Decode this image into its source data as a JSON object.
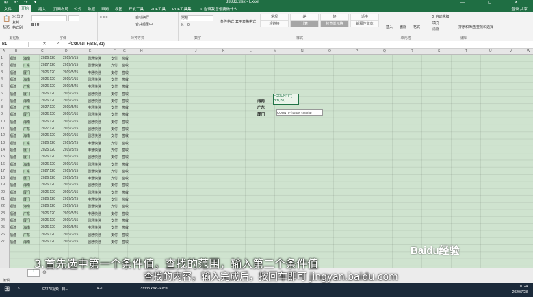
{
  "window": {
    "title": "33333.xlsx - Excel",
    "quick_access": "⊞ ↶ ↷ ▾",
    "controls": "— ▢ ✕"
  },
  "menu": {
    "tabs": [
      "文件",
      "开始",
      "插入",
      "页面布局",
      "公式",
      "数据",
      "审阅",
      "视图",
      "开发工具",
      "PDF工具",
      "PDF工具集"
    ],
    "search": "♀ 告诉我您想要做什么...",
    "right": "登录 共享"
  },
  "ribbon": {
    "clipboard": {
      "label": "剪贴板",
      "paste": "粘贴",
      "cut": "✂ 剪切",
      "copy": "复制",
      "format_painter": "格式刷"
    },
    "font": {
      "label": "字体"
    },
    "alignment": {
      "label": "对齐方式",
      "wrap": "自动换行",
      "merge": "合并后居中"
    },
    "number": {
      "label": "数字",
      "format": "常规"
    },
    "styles": {
      "label": "样式",
      "cond": "条件格式",
      "table": "套用表格格式",
      "items": [
        "常规",
        "差",
        "好",
        "适中",
        "超链接",
        "计算",
        "检查单元格",
        "解释性文本",
        "警告文本",
        "链接"
      ]
    },
    "cells": {
      "label": "单元格",
      "insert": "插入",
      "delete": "删除",
      "format": "格式"
    },
    "editing": {
      "label": "编辑",
      "autosum": "Σ 自动求和",
      "fill": "填充",
      "clear": "清除",
      "sort": "排序和筛选",
      "find": "查找和选择"
    }
  },
  "formula_bar": {
    "name_box": "B1",
    "icons": "✕ ✓ fx",
    "formula": "=COUNTIF(B:B,B1)"
  },
  "columns": [
    "A",
    "B",
    "C",
    "D",
    "E",
    "F",
    "G",
    "H",
    "I",
    "J",
    "K",
    "L",
    "M",
    "N",
    "O",
    "P",
    "Q",
    "R",
    "S",
    "T",
    "U",
    "V",
    "W"
  ],
  "rows": [
    [
      "福建",
      "海南",
      "2026.120",
      "2019/7/15",
      "圆通快递",
      "支付",
      "签收"
    ],
    [
      "福建",
      "广东",
      "2027.120",
      "2019/7/15",
      "圆通快递",
      "支付",
      "签收"
    ],
    [
      "福建",
      "厦门",
      "2026.120",
      "2019/5/25",
      "申通快递",
      "支付",
      "签收"
    ],
    [
      "福建",
      "海南",
      "2026.120",
      "2019/7/15",
      "圆通快递",
      "支付",
      "签收"
    ],
    [
      "福建",
      "广东",
      "2026.120",
      "2019/5/25",
      "申通快递",
      "支付",
      "签收"
    ],
    [
      "福建",
      "厦门",
      "2026.120",
      "2019/7/15",
      "圆通快递",
      "支付",
      "签收"
    ],
    [
      "福建",
      "海南",
      "2026.120",
      "2019/7/15",
      "圆通快递",
      "支付",
      "签收"
    ],
    [
      "福建",
      "广东",
      "2027.120",
      "2019/5/25",
      "申通快递",
      "支付",
      "签收"
    ],
    [
      "福建",
      "厦门",
      "2026.120",
      "2019/7/15",
      "圆通快递",
      "支付",
      "签收"
    ],
    [
      "福建",
      "海南",
      "2026.120",
      "2019/7/15",
      "圆通快递",
      "支付",
      "签收"
    ],
    [
      "福建",
      "广东",
      "2027.120",
      "2019/7/15",
      "圆通快递",
      "支付",
      "签收"
    ],
    [
      "福建",
      "海南",
      "2026.120",
      "2019/7/15",
      "圆通快递",
      "支付",
      "签收"
    ],
    [
      "福建",
      "广东",
      "2026.120",
      "2019/5/25",
      "申通快递",
      "支付",
      "签收"
    ],
    [
      "福建",
      "厦门",
      "2025.120",
      "2019/5/25",
      "申通快递",
      "支付",
      "签收"
    ],
    [
      "福建",
      "厦门",
      "2026.120",
      "2019/7/15",
      "圆通快递",
      "支付",
      "签收"
    ],
    [
      "福建",
      "海南",
      "2026.120",
      "2019/7/15",
      "圆通快递",
      "支付",
      "签收"
    ],
    [
      "福建",
      "广东",
      "2027.120",
      "2019/7/15",
      "圆通快递",
      "支付",
      "签收"
    ],
    [
      "福建",
      "厦门",
      "2026.120",
      "2019/5/25",
      "申通快递",
      "支付",
      "签收"
    ],
    [
      "福建",
      "海南",
      "2026.120",
      "2019/7/15",
      "圆通快递",
      "支付",
      "签收"
    ],
    [
      "福建",
      "厦门",
      "2026.120",
      "2019/7/15",
      "圆通快递",
      "支付",
      "签收"
    ],
    [
      "福建",
      "厦门",
      "2026.120",
      "2019/5/25",
      "申通快递",
      "支付",
      "签收"
    ],
    [
      "福建",
      "海南",
      "2026.120",
      "2019/7/15",
      "圆通快递",
      "支付",
      "签收"
    ],
    [
      "福建",
      "广东",
      "2026.120",
      "2019/5/25",
      "申通快递",
      "支付",
      "签收"
    ],
    [
      "福建",
      "厦门",
      "2026.120",
      "2019/7/15",
      "圆通快递",
      "支付",
      "签收"
    ],
    [
      "福建",
      "海南",
      "2026.120",
      "2019/5/25",
      "申通快递",
      "支付",
      "签收"
    ],
    [
      "福建",
      "广东",
      "2026.120",
      "2019/7/15",
      "圆通快递",
      "支付",
      "签收"
    ],
    [
      "福建",
      "海南",
      "2026.120",
      "2019/7/15",
      "圆通快递",
      "支付",
      "签收"
    ]
  ],
  "right_table": {
    "labels": [
      "海南",
      "广东",
      "厦门"
    ],
    "formula_cell": "=COUNTIF(",
    "formula_cell2": "B:B,B1)",
    "tooltip": "COUNTIF(range, criteria)"
  },
  "sheet": {
    "tab": "1",
    "add": "⊕"
  },
  "status": {
    "mode": "编辑"
  },
  "taskbar": {
    "items": [
      "07278视频 - 目...",
      "0420",
      "33333.xlsx - Excel"
    ],
    "time": "11:24",
    "date": "2020/7/28"
  },
  "subtitle": {
    "line1": "3.首先选中第一个条件值，查找的范围，输入第二个条件值",
    "line2": "查找的内容，输入完成后，按回车即可  jingyan.baidu.com"
  },
  "watermark": {
    "text": "Baidu经验"
  }
}
